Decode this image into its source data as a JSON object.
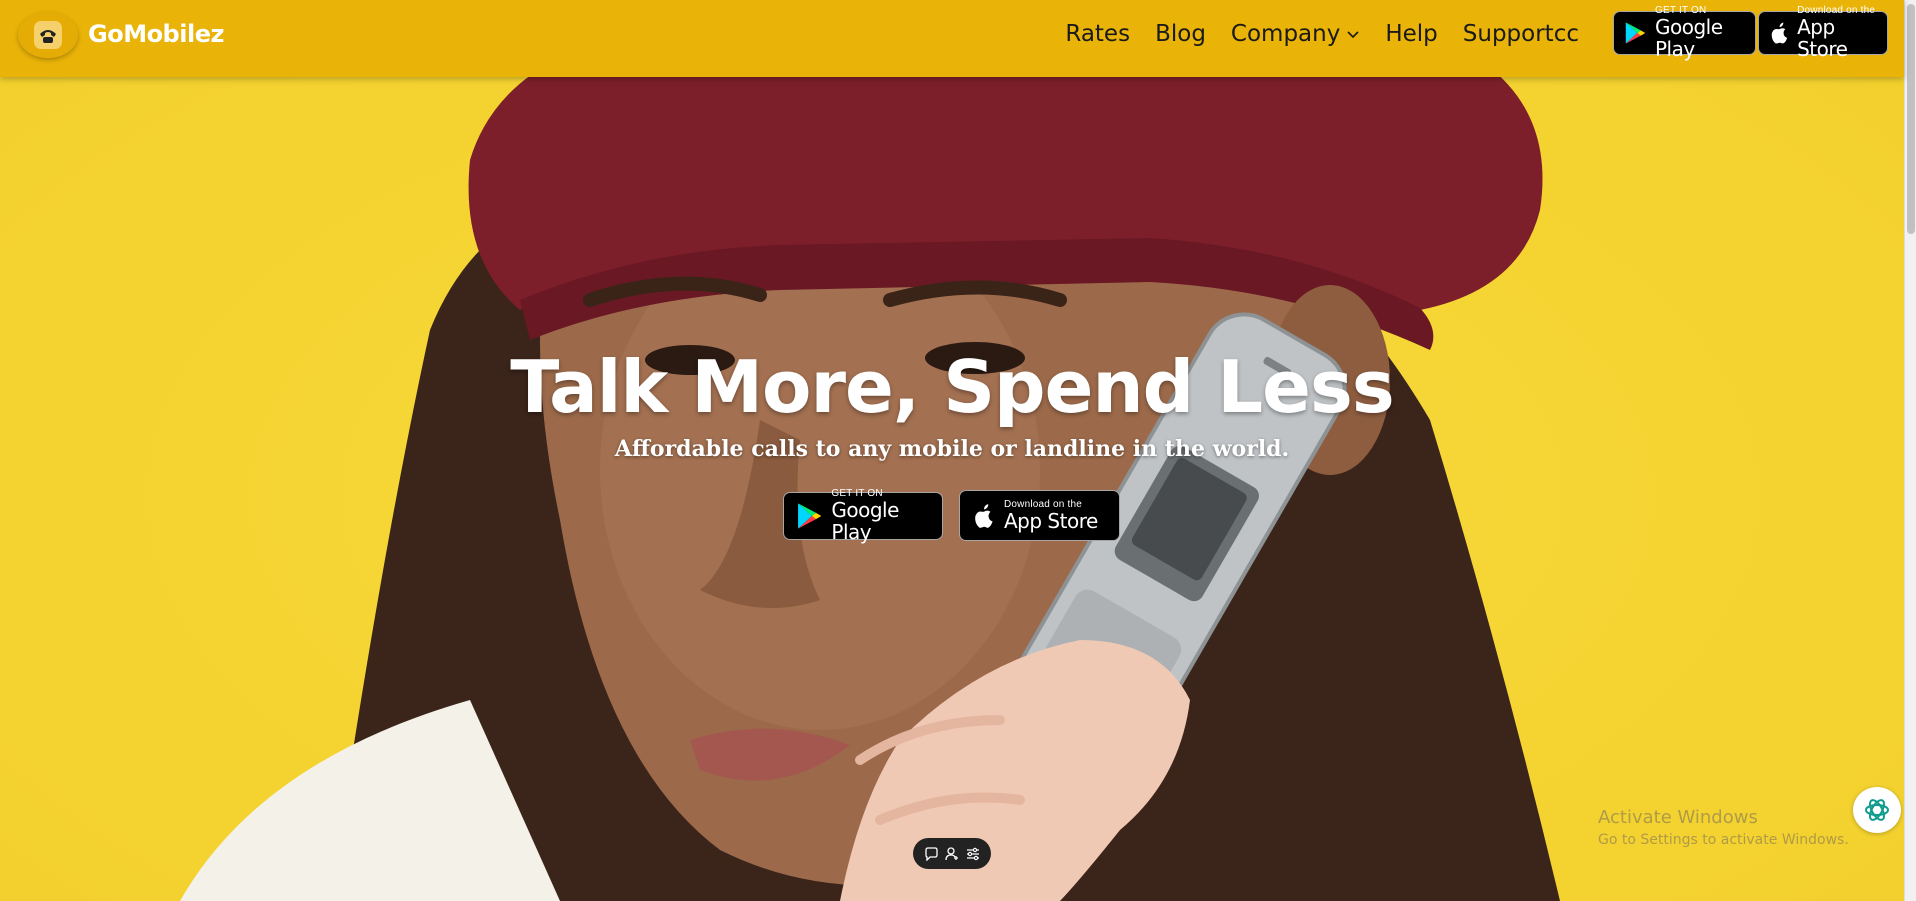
{
  "header": {
    "brand": "GoMobilez",
    "nav": [
      {
        "label": "Rates"
      },
      {
        "label": "Blog"
      },
      {
        "label": "Company",
        "has_dropdown": true
      },
      {
        "label": "Help"
      },
      {
        "label": "Supportcc"
      }
    ],
    "google_play": {
      "small": "GET IT ON",
      "big": "Google Play"
    },
    "app_store": {
      "small": "Download on the",
      "big": "App Store"
    }
  },
  "hero": {
    "headline": "Talk More, Spend Less",
    "subline": "Affordable calls to any mobile or landline in the world.",
    "google_play": {
      "small": "GET IT ON",
      "big": "Google Play"
    },
    "app_store": {
      "small": "Download on the",
      "big": "App Store"
    }
  },
  "widgets": {
    "chat_icon": "openai-swirl-icon",
    "pill_icons": [
      "chat-bubble-icon",
      "person-add-icon",
      "sliders-icon"
    ]
  },
  "watermark": {
    "line1": "Activate Windows",
    "line2": "Go to Settings to activate Windows."
  },
  "colors": {
    "nav_bg": "#e9b308",
    "hero_bg": "#f6d63a",
    "text_white": "#ffffff"
  }
}
